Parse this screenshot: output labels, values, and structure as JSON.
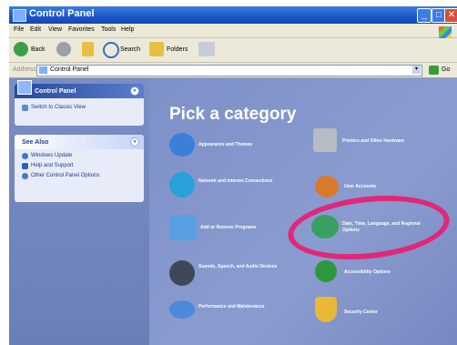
{
  "window": {
    "title": "Control Panel"
  },
  "menu": [
    "File",
    "Edit",
    "View",
    "Favorites",
    "Tools",
    "Help"
  ],
  "toolbar": {
    "back_label": "Back",
    "search_label": "Search",
    "folders_label": "Folders"
  },
  "address": {
    "label": "Address",
    "value": "Control Panel",
    "go_label": "Go"
  },
  "sidebar": {
    "control_panel": {
      "title": "Control Panel",
      "link": "Switch to Classic View"
    },
    "see_also": {
      "title": "See Also",
      "items": [
        "Windows Update",
        "Help and Support",
        "Other Control Panel Options"
      ]
    }
  },
  "main": {
    "heading": "Pick a category",
    "categories": [
      {
        "label": "Appearance and Themes",
        "icon": "appearance-icon",
        "color": "#3c7fd8"
      },
      {
        "label": "Printers and Other Hardware",
        "icon": "printer-icon",
        "color": "#b8bcc4"
      },
      {
        "label": "Network and Internet Connections",
        "icon": "network-icon",
        "color": "#2aa0d8"
      },
      {
        "label": "User Accounts",
        "icon": "users-icon",
        "color": "#d87a2a"
      },
      {
        "label": "Add or Remove Programs",
        "icon": "add-remove-icon",
        "color": "#5a9fe0"
      },
      {
        "label": "Date, Time, Language, and Regional Options",
        "icon": "globe-clock-icon",
        "color": "#3aa060"
      },
      {
        "label": "Sounds, Speech, and Audio Devices",
        "icon": "speaker-icon",
        "color": "#404858"
      },
      {
        "label": "Accessibility Options",
        "icon": "accessibility-icon",
        "color": "#2c9a3c"
      },
      {
        "label": "Performance and Maintenance",
        "icon": "performance-icon",
        "color": "#4a8ad8"
      },
      {
        "label": "Security Center",
        "icon": "shield-icon",
        "color": "#e8b838"
      }
    ]
  },
  "colors": {
    "titlebar": "#1c55c9",
    "highlight_circle": "#e0287a"
  }
}
